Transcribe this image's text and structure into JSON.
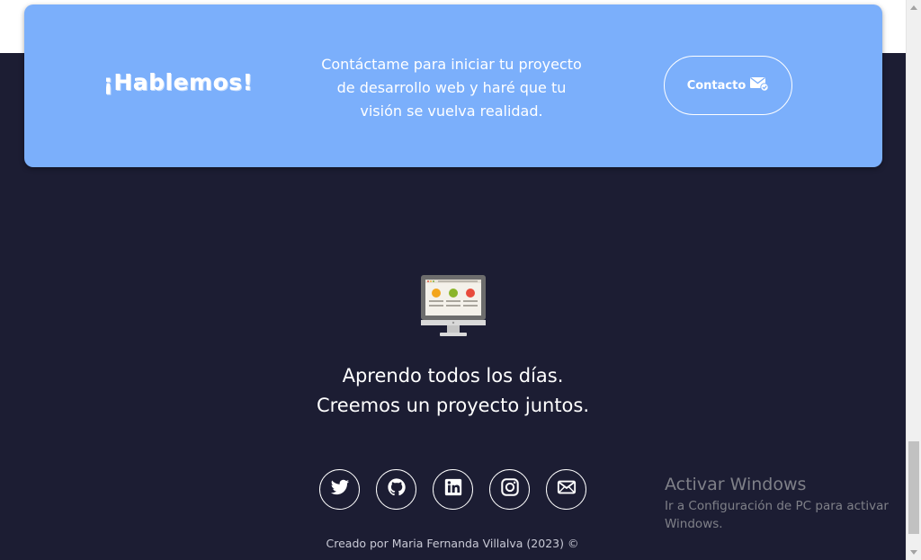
{
  "cta": {
    "title": "¡Hablemos!",
    "text_lines": [
      "Contáctame para iniciar tu proyecto",
      "de desarrollo web y haré que tu",
      "visión se vuelva realidad."
    ],
    "button_label": "Contacto",
    "button_icon": "mail-check-icon",
    "background_color": "#7baffb"
  },
  "footer": {
    "illustration": "monitor-icon",
    "tagline_line1": "Aprendo todos los días.",
    "tagline_line2": "Creemos un proyecto juntos.",
    "social_links": [
      {
        "icon": "twitter-icon"
      },
      {
        "icon": "github-icon"
      },
      {
        "icon": "linkedin-icon"
      },
      {
        "icon": "instagram-icon"
      },
      {
        "icon": "mail-icon"
      }
    ],
    "credit": "Creado por Maria Fernanda Villalva (2023) ©",
    "background_color": "#1c1d33"
  },
  "windows_watermark": {
    "title": "Activar Windows",
    "subtitle": "Ir a Configuración de PC para activar Windows."
  }
}
